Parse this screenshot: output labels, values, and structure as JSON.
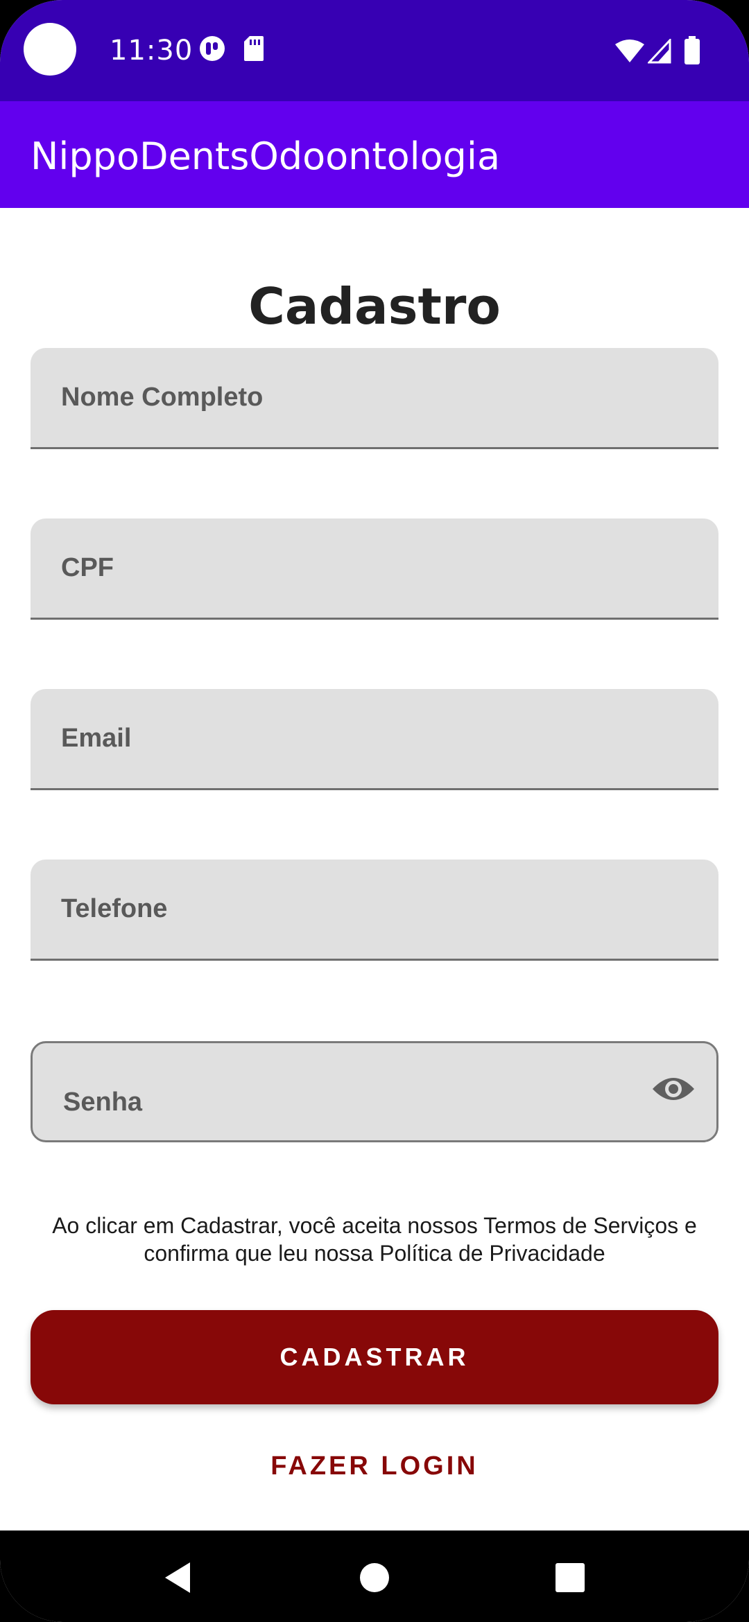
{
  "status_bar": {
    "time": "11:30",
    "icons": [
      "notification-app-icon",
      "sd-card-icon",
      "wifi-icon",
      "signal-icon",
      "battery-icon"
    ]
  },
  "app_bar": {
    "title": "NippoDentsOdoontologia"
  },
  "form": {
    "title": "Cadastro",
    "fields": {
      "name": {
        "label": "Nome Completo",
        "value": ""
      },
      "cpf": {
        "label": "CPF",
        "value": ""
      },
      "email": {
        "label": "Email",
        "value": ""
      },
      "phone": {
        "label": "Telefone",
        "value": ""
      },
      "password": {
        "label": "Senha",
        "value": "",
        "toggle_icon": "eye-icon"
      }
    },
    "terms": "Ao clicar em Cadastrar, você aceita nossos Termos de Serviços e confirma que leu nossa Política de Privacidade",
    "submit_label": "CADASTRAR",
    "login_label": "FAZER LOGIN"
  },
  "nav_bar": {
    "icons": [
      "back-icon",
      "home-icon",
      "recents-icon"
    ]
  },
  "colors": {
    "status_bar": "#3700b3",
    "app_bar": "#6200ee",
    "accent": "#870808",
    "field_bg": "#e0e0e0"
  }
}
